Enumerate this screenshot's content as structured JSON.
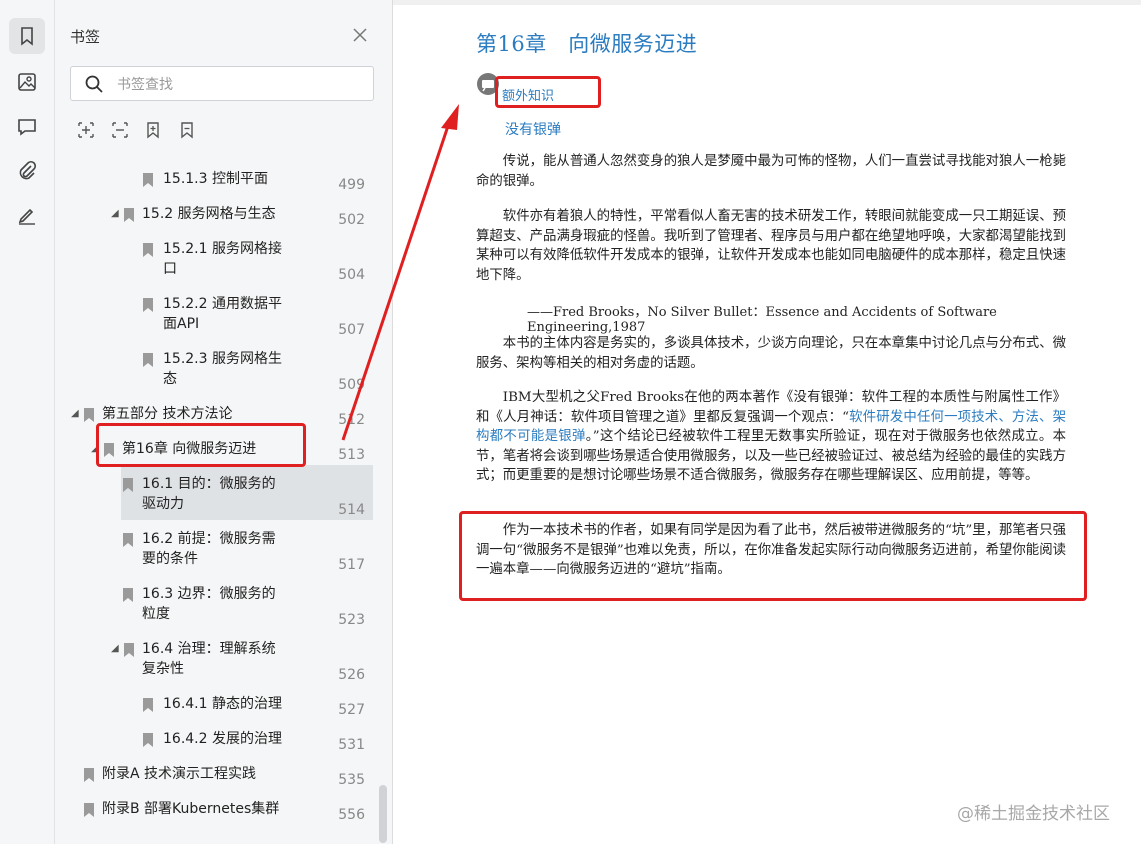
{
  "rail": {
    "items": [
      {
        "name": "bookmark-icon",
        "active": true
      },
      {
        "name": "image-icon",
        "active": false
      },
      {
        "name": "comment-icon",
        "active": false
      },
      {
        "name": "attachment-icon",
        "active": false
      },
      {
        "name": "signature-icon",
        "active": false
      }
    ]
  },
  "panel": {
    "title": "书签",
    "search_placeholder": "书签查找",
    "tools": [
      "add-bookmark-icon",
      "remove-bookmark-icon",
      "bookmark-add-icon",
      "bookmark-remove-icon"
    ]
  },
  "tree": {
    "items": [
      {
        "label": "15.1.3 控制平面",
        "page": "499"
      },
      {
        "label": "15.2 服务网格与生态",
        "page": "502"
      },
      {
        "label": "15.2.1 服务网格接",
        "label2": "口",
        "page": "504"
      },
      {
        "label": "15.2.2 通用数据平",
        "label2": "面API",
        "page": "507"
      },
      {
        "label": "15.2.3 服务网格生",
        "label2": "态",
        "page": "509"
      },
      {
        "label": "第五部分 技术方法论",
        "page": "512"
      },
      {
        "label": "第16章 向微服务迈进",
        "page": "513"
      },
      {
        "label": "16.1 目的：微服务的",
        "label2": "驱动力",
        "page": "514"
      },
      {
        "label": "16.2 前提：微服务需",
        "label2": "要的条件",
        "page": "517"
      },
      {
        "label": "16.3 边界：微服务的",
        "label2": "粒度",
        "page": "523"
      },
      {
        "label": "16.4 治理：理解系统",
        "label2": "复杂性",
        "page": "526"
      },
      {
        "label": "16.4.1 静态的治理",
        "page": "527"
      },
      {
        "label": "16.4.2 发展的治理",
        "page": "531"
      },
      {
        "label": "附录A 技术演示工程实践",
        "page": "535"
      },
      {
        "label": "附录B 部署Kubernetes集群",
        "page": "556"
      }
    ]
  },
  "doc": {
    "chapter_title": "第16章　向微服务迈进",
    "extra_link": "额外知识",
    "sub_title": "没有银弹",
    "p1": "传说，能从普通人忽然变身的狼人是梦魇中最为可怖的怪物，人们一直尝试寻找能对狼人一枪毙命的银弹。",
    "p2": "软件亦有着狼人的特性，平常看似人畜无害的技术研发工作，转眼间就能变成一只工期延误、预算超支、产品满身瑕疵的怪兽。我听到了管理者、程序员与用户都在绝望地呼唤，大家都渴望能找到某种可以有效降低软件开发成本的银弹，让软件开发成本也能如同电脑硬件的成本那样，稳定且快速地下降。",
    "quote": "——Fred Brooks，No Silver Bullet：Essence and Accidents of Software Engineering,1987",
    "p3": "本书的主体内容是务实的，多谈具体技术，少谈方向理论，只在本章集中讨论几点与分布式、微服务、架构等相关的相对务虚的话题。",
    "p4a": "IBM大型机之父Fred Brooks在他的两本著作《没有银弹：软件工程的本质性与附属性工作》和《人月神话：软件项目管理之道》里都反复强调一个观点：“",
    "p4b": "软件研发中任何一项技术、方法、架构都不可能是银弹",
    "p4c": "。”这个结论已经被软件工程里无数事实所验证，现在对于微服务也依然成立。本节，笔者将会谈到哪些场景适合使用微服务，以及一些已经被验证过、被总结为经验的最佳的实践方式；而更重要的是想讨论哪些场景不适合微服务，微服务存在哪些理解误区、应用前提，等等。",
    "p5": "作为一本技术书的作者，如果有同学是因为看了此书，然后被带进微服务的“坑”里，那笔者只强调一句“微服务不是银弹”也难以免责，所以，在你准备发起实际行动向微服务迈进前，希望你能阅读一遍本章——向微服务迈进的“避坑”指南。",
    "watermark": "@稀土掘金技术社区"
  },
  "colors": {
    "link": "#2b7cc0",
    "annotation": "#e02020"
  }
}
